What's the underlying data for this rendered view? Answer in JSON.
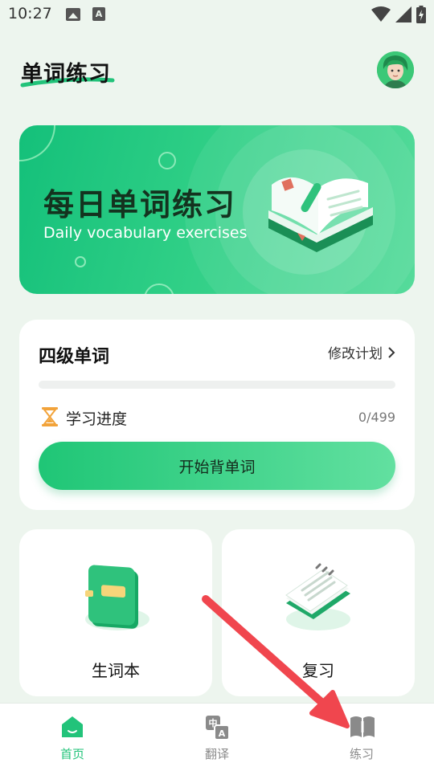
{
  "status_bar": {
    "time": "10:27",
    "image_notification_icon": "image-icon",
    "a_notification_icon": "font-icon",
    "a_glyph": "A",
    "wifi_icon": "wifi-icon",
    "signal_icon": "signal-icon",
    "battery_icon": "battery-icon"
  },
  "header": {
    "title": "单词练习",
    "avatar_icon": "avatar"
  },
  "banner": {
    "title": "每日单词练习",
    "subtitle": "Daily vocabulary exercises",
    "illustration_icon": "open-book-icon"
  },
  "word_card": {
    "title": "四级单词",
    "edit_plan_label": "修改计划",
    "progress_label": "学习进度",
    "progress_count": "0/499",
    "progress_value": 0,
    "start_button_label": "开始背单词"
  },
  "features": [
    {
      "label": "生词本",
      "icon": "notebook-icon"
    },
    {
      "label": "复习",
      "icon": "notepad-icon"
    }
  ],
  "bottom_nav": {
    "items": [
      {
        "label": "首页",
        "icon": "home-icon",
        "active": true
      },
      {
        "label": "翻译",
        "icon": "translate-icon",
        "active": false,
        "glyph_top": "中",
        "glyph_bottom": "A"
      },
      {
        "label": "练习",
        "icon": "practice-book-icon",
        "active": false
      }
    ]
  },
  "colors": {
    "accent": "#22C37A",
    "background": "#EDF5EE",
    "banner_gradient_start": "#14C07A",
    "banner_gradient_end": "#56DB9B",
    "nav_active": "#22C37A",
    "nav_inactive": "#8A8A8A",
    "annotation_arrow": "#F0464E"
  }
}
